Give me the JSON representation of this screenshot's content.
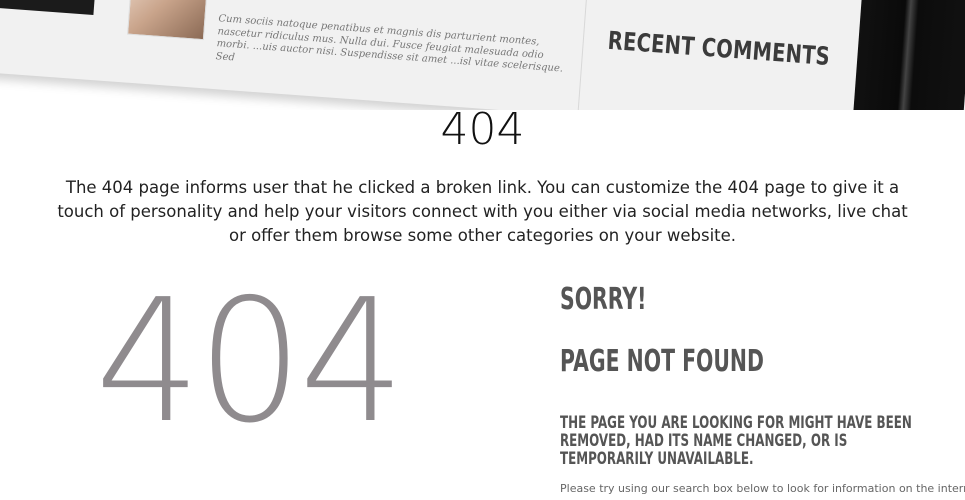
{
  "banner": {
    "post_excerpt": "Cum sociis natoque penatibus et magnis dis parturient montes, nascetur ridiculus mus. Nulla dui. Fusce feugiat malesuada odio morbi. ...uis auctor nisi. Suspendisse sit amet ...isl vitae scelerisque. Sed",
    "recent_comments_heading": "RECENT COMMENTS"
  },
  "main": {
    "title": "404",
    "intro": "The 404 page informs user that he clicked a broken link. You can customize the 404 page to give it a touch of personality and help your visitors connect with you either via social media networks, live chat or offer them browse some other categories on your website.",
    "big_code": "404",
    "sorry": "SORRY!",
    "not_found": "PAGE NOT FOUND",
    "unavailable": "THE PAGE YOU ARE LOOKING FOR MIGHT HAVE BEEN REMOVED, HAD ITS NAME CHANGED, OR IS TEMPORARILY UNAVAILABLE.",
    "hint": "Please try using our search box below to look for information on the internet."
  },
  "colors": {
    "big_code": "#8f8b8e",
    "heading": "#555555"
  }
}
